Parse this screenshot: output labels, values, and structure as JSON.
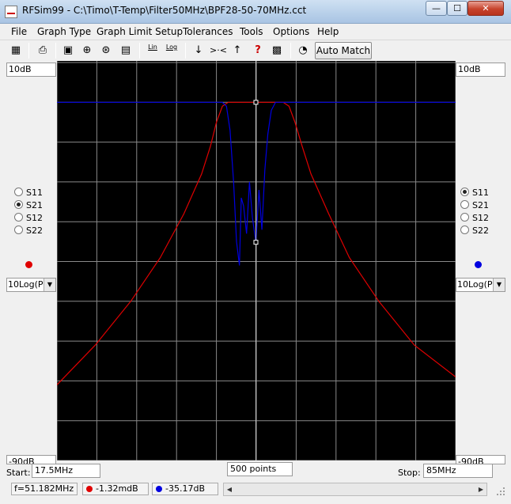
{
  "window": {
    "title": "RFSim99 - C:\\Timo\\T-Temp\\Filter50MHz\\BPF28-50-70MHz.cct"
  },
  "caption_buttons": {
    "minimize": "—",
    "maximize": "☐",
    "close": "✕"
  },
  "menu": [
    "File",
    "Graph Type",
    "Graph Limit Setup",
    "Tolerances",
    "Tools",
    "Options",
    "Help"
  ],
  "toolbar": {
    "icons": [
      "component-grid-icon",
      "print-icon",
      "graph-rect-icon",
      "polar-icon",
      "smith-icon",
      "table-icon",
      "lin-icon",
      "log-icon",
      "arrow-down-icon",
      "zoom-in-icon",
      "arrow-up-icon",
      "help-cursor-icon",
      "chip-icon",
      "match-icon"
    ],
    "lin_label": "Lin",
    "log_label": "Log",
    "auto_match_label": "Auto Match"
  },
  "left_panel": {
    "scale_top": "10dB",
    "scale_bottom": "-90dB",
    "params": [
      "S11",
      "S21",
      "S12",
      "S22"
    ],
    "selected": "S21",
    "trace_color": "#e00000",
    "format": "10Log(P)"
  },
  "right_panel": {
    "scale_top": "10dB",
    "scale_bottom": "-90dB",
    "params": [
      "S11",
      "S21",
      "S12",
      "S22"
    ],
    "selected": "S11",
    "trace_color": "#0000e0",
    "format": "10Log(P)"
  },
  "bottom": {
    "start_label": "Start:",
    "start_value": "17.5MHz",
    "points_value": "500 points",
    "stop_label": "Stop:",
    "stop_value": "85MHz"
  },
  "status": {
    "frequency": "f=51.182MHz",
    "s21_value": "-1.32mdB",
    "s11_value": "-35.17dB"
  },
  "chart_data": {
    "type": "line",
    "x_range_mhz": [
      17.5,
      85
    ],
    "y_range_db": [
      -90,
      10
    ],
    "grid": true,
    "grid_divisions": {
      "x": 10,
      "y": 10
    },
    "marker_mhz": 51.182,
    "series": [
      {
        "name": "S21",
        "color": "#e00000",
        "points": [
          [
            17.5,
            -71
          ],
          [
            24,
            -61
          ],
          [
            30,
            -50
          ],
          [
            35,
            -39
          ],
          [
            39,
            -28
          ],
          [
            42,
            -18
          ],
          [
            43.5,
            -11
          ],
          [
            44.5,
            -5
          ],
          [
            45.5,
            -1
          ],
          [
            46.5,
            0
          ],
          [
            48,
            0
          ],
          [
            51.182,
            0
          ],
          [
            54,
            0
          ],
          [
            55.8,
            0
          ],
          [
            56.8,
            -1
          ],
          [
            57.8,
            -5
          ],
          [
            59,
            -11
          ],
          [
            60.5,
            -18
          ],
          [
            63.5,
            -28
          ],
          [
            67,
            -39
          ],
          [
            72,
            -50
          ],
          [
            78,
            -61
          ],
          [
            85,
            -69
          ]
        ]
      },
      {
        "name": "S11",
        "color": "#0000e0",
        "points": [
          [
            17.5,
            0
          ],
          [
            45.5,
            0
          ],
          [
            46.2,
            -1
          ],
          [
            46.8,
            -7
          ],
          [
            47.4,
            -20
          ],
          [
            47.9,
            -35
          ],
          [
            48.4,
            -41
          ],
          [
            48.7,
            -24
          ],
          [
            49.1,
            -26
          ],
          [
            49.6,
            -33
          ],
          [
            50.1,
            -20
          ],
          [
            50.6,
            -29
          ],
          [
            51.182,
            -35.17
          ],
          [
            51.7,
            -22
          ],
          [
            52.2,
            -32
          ],
          [
            52.7,
            -17
          ],
          [
            53.2,
            -8
          ],
          [
            53.8,
            -2
          ],
          [
            54.5,
            0
          ],
          [
            85,
            0
          ]
        ]
      }
    ]
  }
}
